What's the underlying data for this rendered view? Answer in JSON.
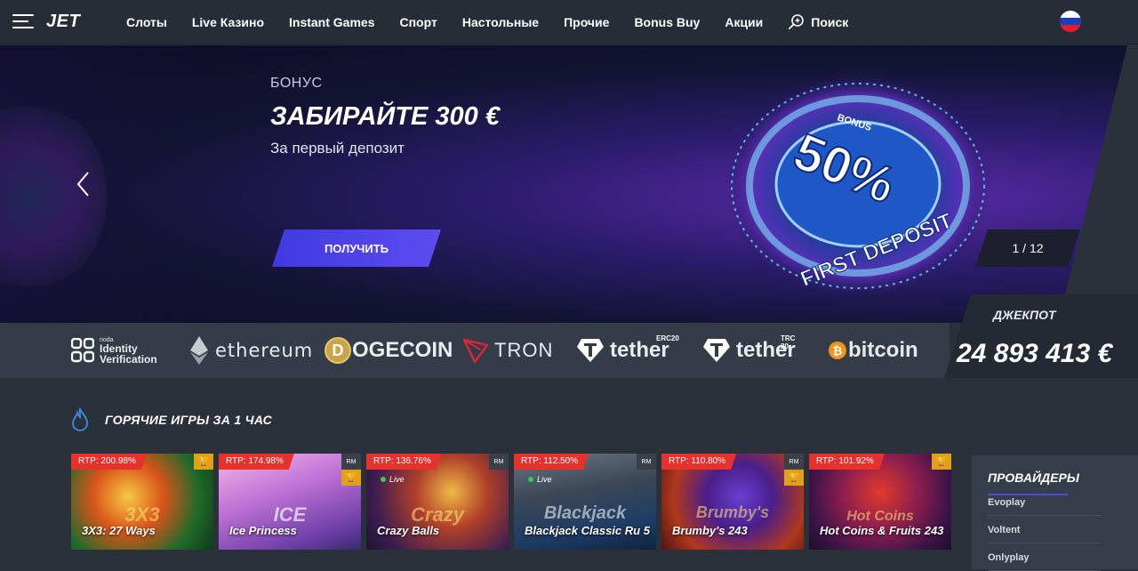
{
  "header": {
    "logo": "JET",
    "nav": [
      "Слоты",
      "Live Казино",
      "Instant Games",
      "Спорт",
      "Настольные",
      "Прочие",
      "Bonus Buy",
      "Акции"
    ],
    "search_label": "Поиск",
    "language_flag": "russia-flag-icon"
  },
  "hero": {
    "kicker": "БОНУС",
    "title": "ЗАБИРАЙТЕ 300 €",
    "subtitle": "За первый депозит",
    "cta_label": "ПОЛУЧИТЬ",
    "badge": {
      "top": "BONUS",
      "percent": "50%",
      "bottom": "FIRST DEPOSIT"
    },
    "slide_counter": "1 / 12"
  },
  "payments": {
    "noda_small": "noda",
    "noda_line1": "Identity",
    "noda_line2": "Verification",
    "ethereum": "ethereum",
    "dogecoin": "OGECOIN",
    "tron": "TRON",
    "tether_1": "tether",
    "tether_1_tag": "ERC20",
    "tether_2": "tether",
    "tether_2_tag": "TRC 20",
    "bitcoin": "bitcoin"
  },
  "jackpot": {
    "label": "ДЖЕКПОТ",
    "value": "24 893 413 €"
  },
  "hot_games": {
    "title": "ГОРЯЧИЕ ИГРЫ ЗА 1 ЧАС",
    "games": [
      {
        "rtp": "RTP: 200.98%",
        "name": "3X3: 27 Ways",
        "deco": "3X3"
      },
      {
        "rtp": "RTP: 174.98%",
        "name": "Ice Princess",
        "deco": "ICE"
      },
      {
        "rtp": "RTP: 136.76%",
        "name": "Crazy Balls",
        "deco": "Crazy",
        "live": "Live"
      },
      {
        "rtp": "RTP: 112.50%",
        "name": "Blackjack Classic Ru 5",
        "deco": "Blackjack",
        "live": "Live"
      },
      {
        "rtp": "RTP: 110.80%",
        "name": "Brumby's 243",
        "deco": "Brumby's"
      },
      {
        "rtp": "RTP: 101.92%",
        "name": "Hot Coins & Fruits 243",
        "deco": "Hot Coins"
      }
    ]
  },
  "providers": {
    "title": "ПРОВАЙДЕРЫ",
    "items": [
      "Evoplay",
      "Voltent",
      "Onlyplay"
    ]
  },
  "colors": {
    "background": "#2a313b",
    "header": "#272d36",
    "accent": "#4e47e6",
    "rtp_badge": "#e5322d",
    "trophy_badge": "#e0a01a"
  }
}
